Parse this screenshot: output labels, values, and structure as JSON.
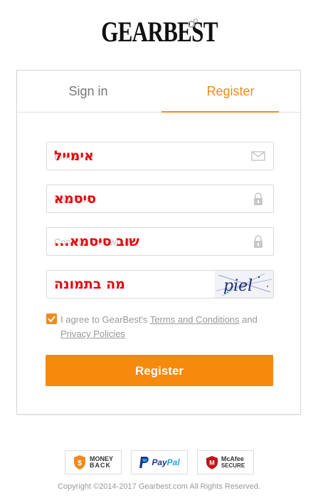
{
  "brand": {
    "name": "GEARBEST"
  },
  "tabs": {
    "signin": "Sign in",
    "register": "Register"
  },
  "form": {
    "email": {
      "placeholder": "Email",
      "overlay": "אימייל"
    },
    "password": {
      "placeholder": "Password",
      "overlay": "סיסמא"
    },
    "confirm": {
      "placeholder": "Confirm Password",
      "overlay": "שוב סיסמא..."
    },
    "captcha": {
      "placeholder": "",
      "overlay": "מה בתמונה",
      "image_text": "piel"
    }
  },
  "agree": {
    "prefix": "I agree to GearBest's ",
    "terms": "Terms and Conditions",
    "and": " and ",
    "privacy": "Privacy Policies",
    "checked": true
  },
  "register_button": "Register",
  "badges": {
    "money_back": [
      "MONEY",
      "BACK"
    ],
    "paypal": [
      "Pay",
      "Pal"
    ],
    "mcafee": [
      "McAfee",
      "SECURE"
    ]
  },
  "footer": {
    "copyright": "Copyright ©2014-2017 Gearbest.com All Rights Reserved."
  },
  "colors": {
    "accent": "#f28a1b",
    "button": "#f7890c",
    "overlay_text": "#e8000b"
  }
}
